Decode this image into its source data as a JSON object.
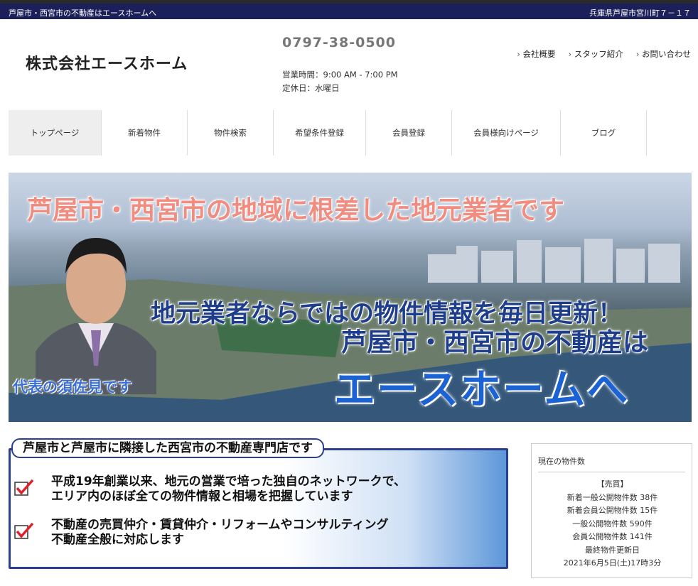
{
  "topbar": {
    "left": "芦屋市・西宮市の不動産はエースホームへ",
    "right": "兵庫県芦屋市宮川町７－１７"
  },
  "header": {
    "logo": "株式会社エースホーム",
    "phone": "0797-38-0500",
    "hours": "営業時間：9:00 AM - 7:00 PM",
    "holiday": "定休日：水曜日",
    "links": [
      "会社概要",
      "スタッフ紹介",
      "お問い合わせ"
    ]
  },
  "nav": [
    "トップページ",
    "新着物件",
    "物件検索",
    "希望条件登録",
    "会員登録",
    "会員様向けページ",
    "ブログ"
  ],
  "banner": {
    "line1": "芦屋市・西宮市の地域に根差した地元業者です",
    "line2": "地元業者ならではの物件情報を毎日更新！",
    "line3": "芦屋市・西宮市の不動産は",
    "line4": "エースホームへ",
    "caption": "代表の須佐見です"
  },
  "feature": {
    "title": "芦屋市と芦屋市に隣接した西宮市の不動産専門店です",
    "item1_a": "平成19年創業以来、地元の営業で培った独自のネットワークで、",
    "item1_b": "エリア内のほぼ全ての物件情報と相場を把握しています",
    "item2_a": "不動産の売買仲介・賃貸仲介・リフォームやコンサルティング",
    "item2_b": "不動産全般に対応します"
  },
  "sidebar": {
    "heading": "現在の物件数",
    "category": "【売買】",
    "rows": [
      "新着一般公開物件数 38件",
      "新着会員公開物件数 15件",
      "一般公開物件数 590件",
      "会員公開物件数 141件",
      "最終物件更新日",
      "2021年6月5日(土)17時3分"
    ]
  }
}
